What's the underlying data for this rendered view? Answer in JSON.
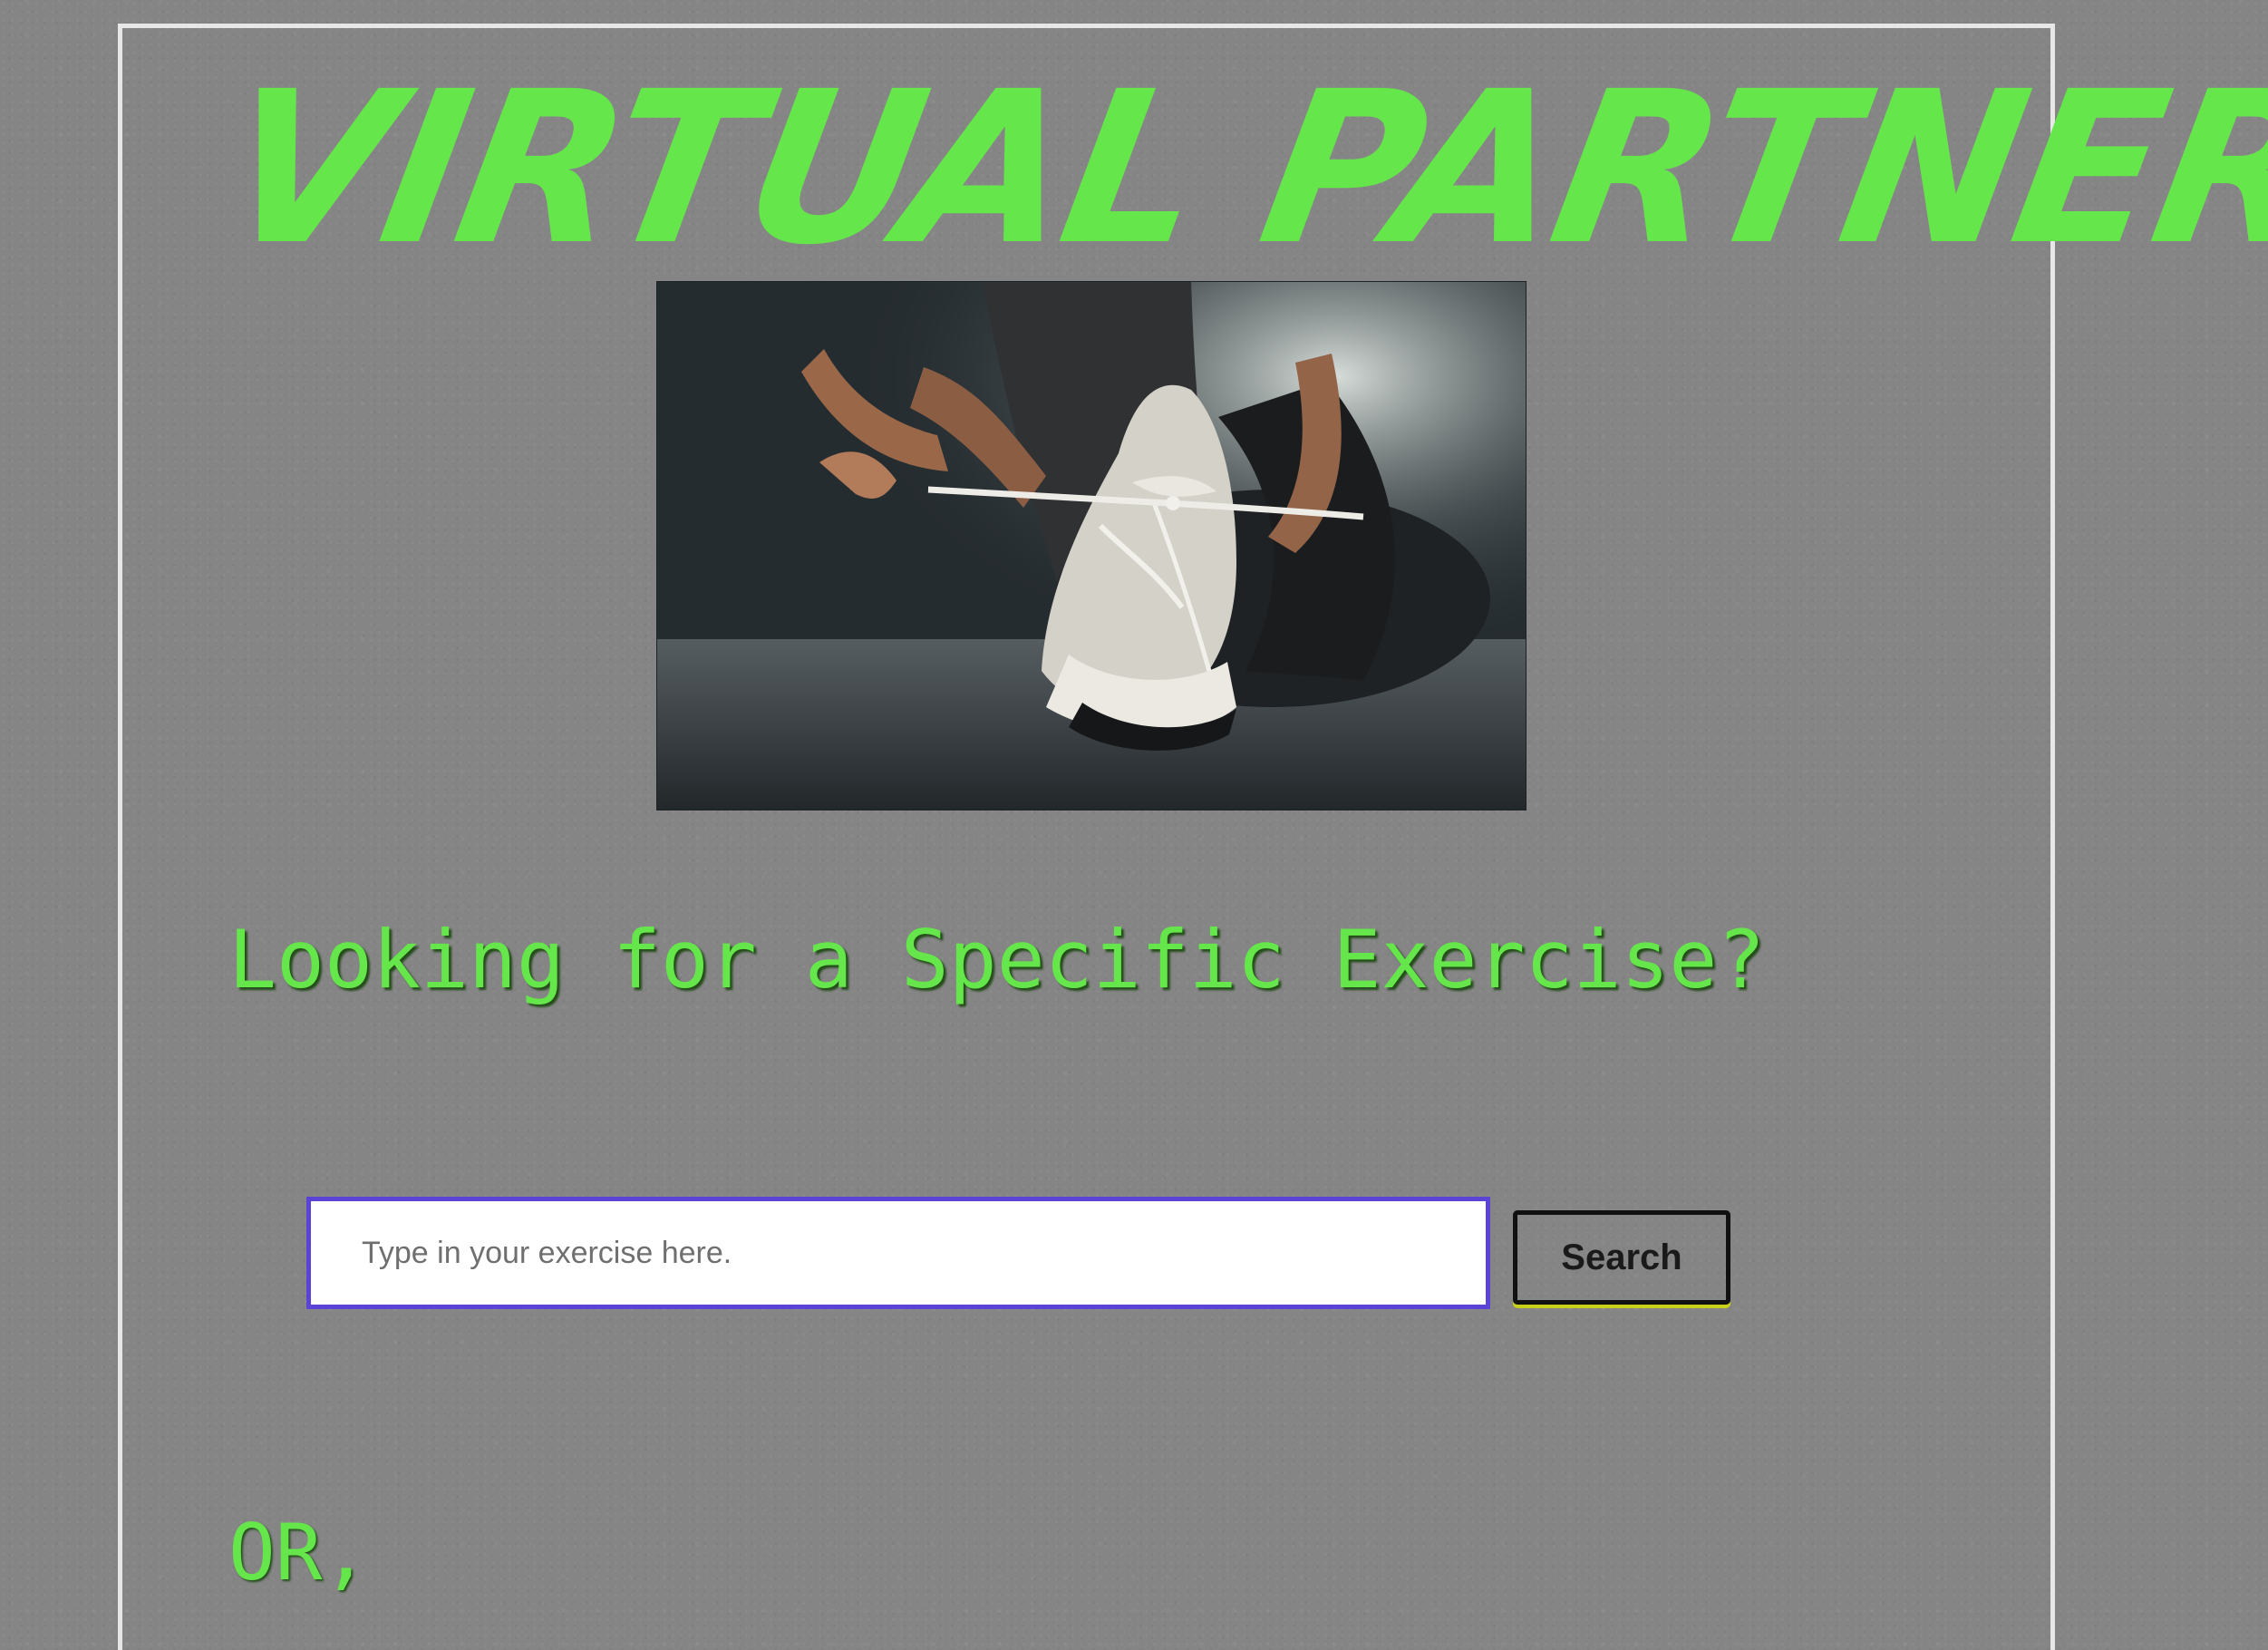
{
  "page": {
    "site_title": "Virtual Partner",
    "hero_image": "person tying running shoe",
    "section_heading": "Looking for a Specific Exercise?",
    "search": {
      "placeholder": "Type in your exercise here.",
      "button_label": "Search"
    },
    "or_label": "OR,"
  },
  "colors": {
    "background": "#858585",
    "frame_border": "#e7e7e7",
    "accent_green": "#65e64a",
    "input_border": "#5b43d6",
    "button_border": "#111111"
  },
  "icons": {
    "hero": "running-shoe-photo"
  }
}
